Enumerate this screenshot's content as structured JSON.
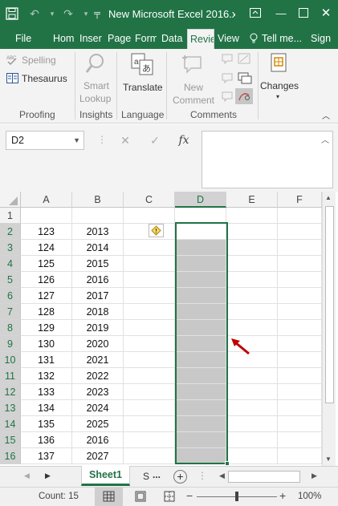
{
  "titlebar": {
    "title": "New Microsoft Excel 2016.xl..."
  },
  "tabs": [
    {
      "label": "File",
      "active": false
    },
    {
      "label": "Hom",
      "active": false
    },
    {
      "label": "Inser",
      "active": false
    },
    {
      "label": "Page",
      "active": false
    },
    {
      "label": "Form",
      "active": false
    },
    {
      "label": "Data",
      "active": false
    },
    {
      "label": "Revie",
      "active": true
    },
    {
      "label": "View",
      "active": false
    },
    {
      "label": "Tell me...",
      "active": false
    },
    {
      "label": "Sign",
      "active": false
    }
  ],
  "ribbon": {
    "proofing": {
      "spelling": "Spelling",
      "thesaurus": "Thesaurus",
      "group_label": "Proofing"
    },
    "insights": {
      "smart": "Smart",
      "lookup": "Lookup",
      "group_label": "Insights"
    },
    "language": {
      "translate": "Translate",
      "group_label": "Language"
    },
    "comments": {
      "new": "New",
      "comment": "Comment",
      "group_label": "Comments"
    },
    "changes": {
      "label": "Changes"
    }
  },
  "formula_bar": {
    "name_box": "D2",
    "fx_label": "fx",
    "value": ""
  },
  "grid": {
    "columns": [
      "A",
      "B",
      "C",
      "D",
      "E",
      "F"
    ],
    "selected_column": "D",
    "rows": [
      {
        "n": "1",
        "a": "",
        "b": ""
      },
      {
        "n": "2",
        "a": "123",
        "b": "2013"
      },
      {
        "n": "3",
        "a": "124",
        "b": "2014"
      },
      {
        "n": "4",
        "a": "125",
        "b": "2015"
      },
      {
        "n": "5",
        "a": "126",
        "b": "2016"
      },
      {
        "n": "6",
        "a": "127",
        "b": "2017"
      },
      {
        "n": "7",
        "a": "128",
        "b": "2018"
      },
      {
        "n": "8",
        "a": "129",
        "b": "2019"
      },
      {
        "n": "9",
        "a": "130",
        "b": "2020"
      },
      {
        "n": "10",
        "a": "131",
        "b": "2021"
      },
      {
        "n": "11",
        "a": "132",
        "b": "2022"
      },
      {
        "n": "12",
        "a": "133",
        "b": "2023"
      },
      {
        "n": "13",
        "a": "134",
        "b": "2024"
      },
      {
        "n": "14",
        "a": "135",
        "b": "2025"
      },
      {
        "n": "15",
        "a": "136",
        "b": "2016"
      },
      {
        "n": "16",
        "a": "137",
        "b": "2027"
      }
    ]
  },
  "sheets": {
    "active": "Sheet1",
    "next": "S",
    "more": "..."
  },
  "status": {
    "count": "Count: 15",
    "zoom": "100%"
  },
  "colors": {
    "accent": "#217346",
    "selection_fill": "#c8c8c8",
    "arrow": "#c00000"
  }
}
